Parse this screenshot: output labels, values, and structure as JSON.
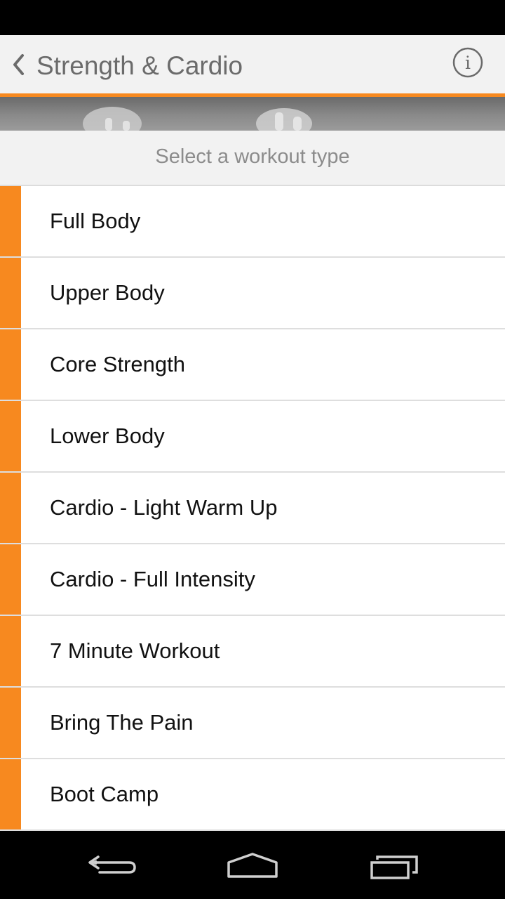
{
  "header": {
    "title": "Strength & Cardio",
    "back_icon": "chevron-left-icon",
    "info_icon": "info-icon"
  },
  "subheader": {
    "text": "Select a workout type"
  },
  "workouts": [
    {
      "label": "Full Body"
    },
    {
      "label": "Upper Body"
    },
    {
      "label": "Core Strength"
    },
    {
      "label": "Lower Body"
    },
    {
      "label": "Cardio - Light Warm Up"
    },
    {
      "label": "Cardio - Full Intensity"
    },
    {
      "label": "7 Minute Workout"
    },
    {
      "label": "Bring The Pain"
    },
    {
      "label": "Boot Camp"
    }
  ],
  "colors": {
    "accent": "#f7891f",
    "header_bg": "#f2f2f2",
    "title_text": "#6b6b6b"
  },
  "navigation": [
    "back-nav-icon",
    "home-nav-icon",
    "recents-nav-icon"
  ]
}
